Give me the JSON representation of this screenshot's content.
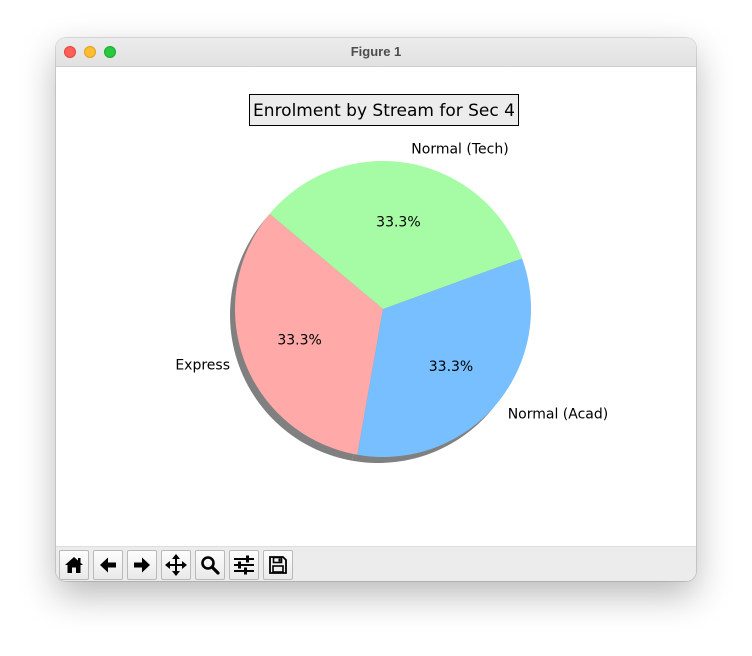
{
  "window": {
    "title": "Figure 1"
  },
  "toolbar": {
    "buttons": [
      {
        "name": "home-icon"
      },
      {
        "name": "back-arrow-icon"
      },
      {
        "name": "forward-arrow-icon"
      },
      {
        "name": "pan-move-icon"
      },
      {
        "name": "zoom-magnifier-icon"
      },
      {
        "name": "configure-subplots-icon"
      },
      {
        "name": "save-floppy-icon"
      }
    ]
  },
  "chart_data": {
    "type": "pie",
    "title": "Enrolment by Stream for Sec 4",
    "labels": [
      "Express",
      "Normal (Acad)",
      "Normal (Tech)"
    ],
    "values": [
      1,
      1,
      1
    ],
    "percent_labels": [
      "33.3%",
      "33.3%",
      "33.3%"
    ],
    "colors": [
      "#ffaaa8",
      "#77bfff",
      "#a6fba5"
    ],
    "start_angle_deg": 140,
    "shadow": true,
    "autopct": "%1.1f%%"
  }
}
